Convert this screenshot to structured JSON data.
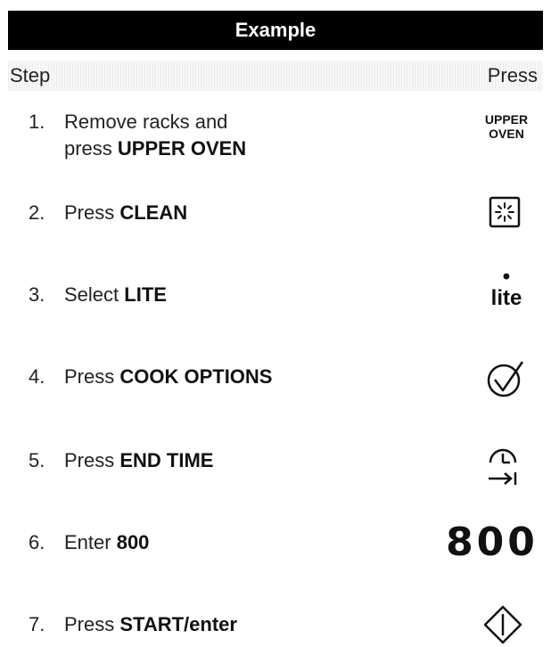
{
  "title": "Example",
  "header": {
    "step": "Step",
    "press": "Press"
  },
  "steps": [
    {
      "num": "1.",
      "line1": "Remove racks and",
      "prefix": "press ",
      "bold": "UPPER OVEN"
    },
    {
      "num": "2.",
      "prefix": "Press ",
      "bold": "CLEAN"
    },
    {
      "num": "3.",
      "prefix": "Select ",
      "bold": "LITE"
    },
    {
      "num": "4.",
      "prefix": "Press ",
      "bold": "COOK OPTIONS"
    },
    {
      "num": "5.",
      "prefix": "Press ",
      "bold": "END TIME"
    },
    {
      "num": "6.",
      "prefix": "Enter ",
      "bold": "800"
    },
    {
      "num": "7.",
      "prefix": "Press ",
      "bold": "START/enter"
    }
  ],
  "press": {
    "upper_oven_line1": "UPPER",
    "upper_oven_line2": "OVEN",
    "clean_icon": "clean-sparkle-icon",
    "lite_dot": "•",
    "lite_label": "lite",
    "cook_options_icon": "check-circle-icon",
    "end_time_icon": "clock-end-arrow-icon",
    "enter_value": "800",
    "start_icon": "start-diamond-icon"
  }
}
